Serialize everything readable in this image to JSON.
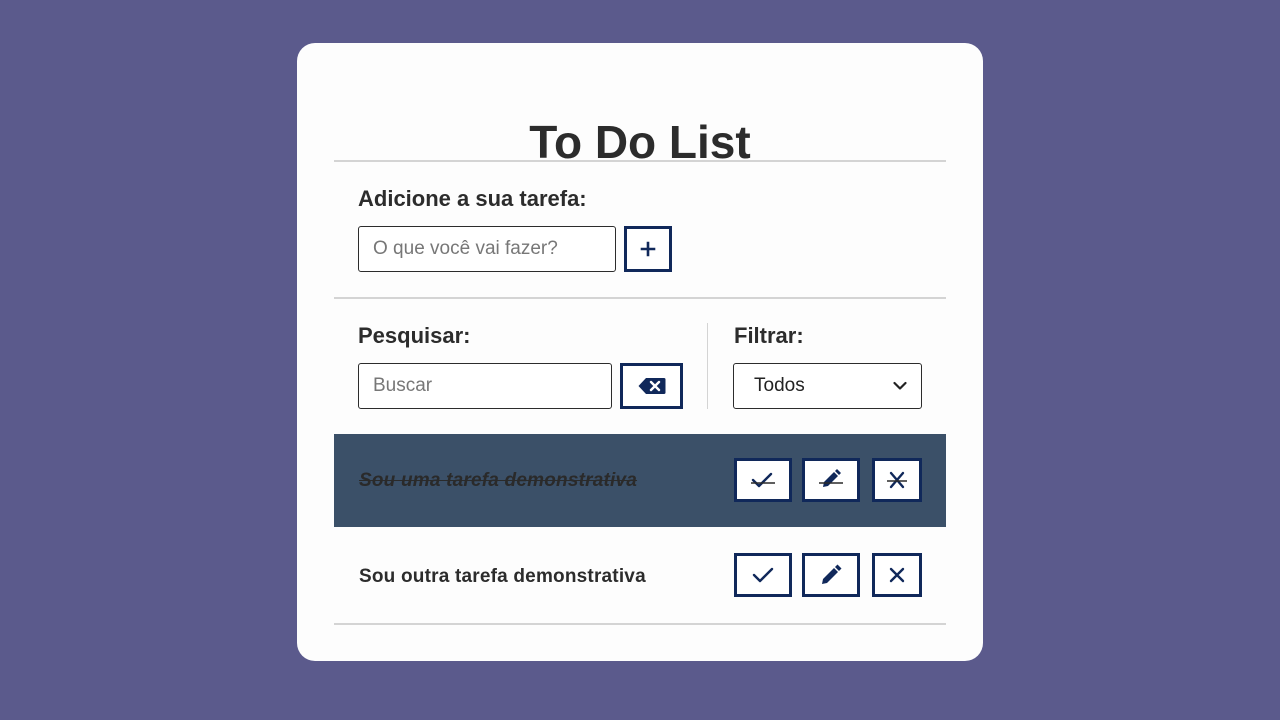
{
  "app": {
    "title": "To Do List"
  },
  "add_section": {
    "label": "Adicione a sua tarefa:",
    "input_placeholder": "O que você vai fazer?",
    "input_value": "",
    "add_button_icon": "plus-icon"
  },
  "search_section": {
    "label": "Pesquisar:",
    "input_placeholder": "Buscar",
    "input_value": "",
    "clear_button_icon": "backspace-icon"
  },
  "filter_section": {
    "label": "Filtrar:",
    "selected": "Todos",
    "dropdown_icon": "chevron-down-icon"
  },
  "todos": [
    {
      "text": "Sou uma tarefa demonstrativa",
      "done": true,
      "actions": [
        "check-icon",
        "pencil-icon",
        "close-icon"
      ]
    },
    {
      "text": "Sou outra tarefa demonstrativa",
      "done": false,
      "actions": [
        "check-icon",
        "pencil-icon",
        "close-icon"
      ]
    }
  ],
  "colors": {
    "background": "#5b5a8c",
    "card": "#fdfdfd",
    "button_border": "#10285a",
    "done_row": "#3b5068",
    "text": "#2c2c2c"
  }
}
